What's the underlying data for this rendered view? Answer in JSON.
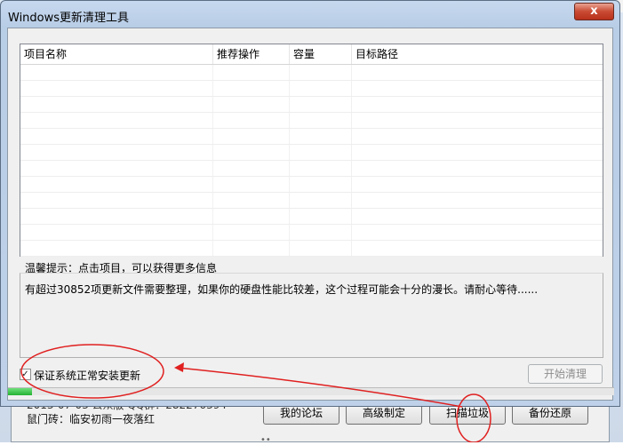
{
  "dialog": {
    "title": "Windows更新清理工具",
    "close_label": "x"
  },
  "list": {
    "columns": [
      "项目名称",
      "推荐操作",
      "容量",
      "目标路径"
    ],
    "rows": []
  },
  "tip": {
    "label": "温馨提示：点击项目，可以获得更多信息",
    "text": "有超过30852项更新文件需要整理，如果你的硬盘性能比较差，这个过程可能会十分的漫长。请耐心等待......"
  },
  "options": {
    "keep_updates_label": "保证系统正常安装更新",
    "keep_updates_checked": true,
    "check_glyph": "✓"
  },
  "start_button": {
    "label": "开始清理",
    "enabled": false
  },
  "progress": {
    "value": 0.04,
    "color": "#2dbb3a"
  },
  "background_app": {
    "info_line1": "2013-07-03 公众版 QQ群：282276394",
    "info_line2": "鼠门砖：临安初雨一夜落红",
    "buttons": [
      "我的论坛",
      "高级制定",
      "扫描垃圾",
      "备份还原"
    ]
  },
  "annotation_color": "#e02020"
}
